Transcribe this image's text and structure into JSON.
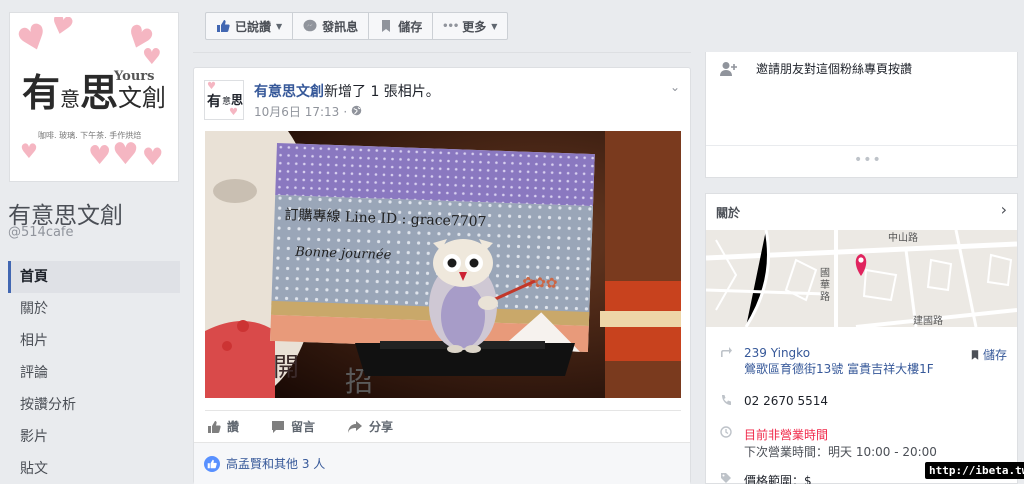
{
  "page": {
    "name": "有意思文創",
    "handle": "@514cafe"
  },
  "logo": {
    "big_char_1": "有",
    "small_char": "意",
    "big_char_2": "思",
    "small_chars": "文創",
    "yours": "Yours",
    "subtitle": "咖啡. 玻璃. 下午茶. 手作烘焙"
  },
  "nav": {
    "items": [
      {
        "label": "首頁",
        "active": true
      },
      {
        "label": "關於"
      },
      {
        "label": "相片"
      },
      {
        "label": "評論"
      },
      {
        "label": "按讚分析"
      },
      {
        "label": "影片"
      },
      {
        "label": "貼文"
      }
    ]
  },
  "toolbar": {
    "liked_label": "已說讚",
    "message_label": "發訊息",
    "save_label": "儲存",
    "more_label": "更多"
  },
  "post": {
    "author": "有意思文創",
    "action_text": "新增了 1 張相片。",
    "timestamp": "10月6日 17:13",
    "photo": {
      "card_text": "訂購專線 Line ID : grace7707",
      "card_script": "Bonne journée"
    },
    "like_label": "讚",
    "comment_label": "留言",
    "share_label": "分享",
    "likes_text": "高孟賢和其他 3 人"
  },
  "invite": {
    "text": "邀請朋友對這個粉絲專頁按讚",
    "more": "•••"
  },
  "about": {
    "title": "關於",
    "map_labels": {
      "road1": "中山路",
      "road2": "國華路",
      "road3": "建國路"
    },
    "address_line1": "239 Yingko",
    "address_line2": "鶯歌區育德街13號 富貴吉祥大樓1F",
    "save_label": "儲存",
    "phone": "02 2670 5514",
    "status": "目前非營業時間",
    "next_hours": "下次營業時間：明天 10:00 - 20:00",
    "price_range": "價格範圍：$"
  },
  "watermark": "http://ibeta.tw",
  "colors": {
    "link": "#365899",
    "closed": "#f02849",
    "accent": "#4267b2",
    "pin": "#e0245e"
  }
}
